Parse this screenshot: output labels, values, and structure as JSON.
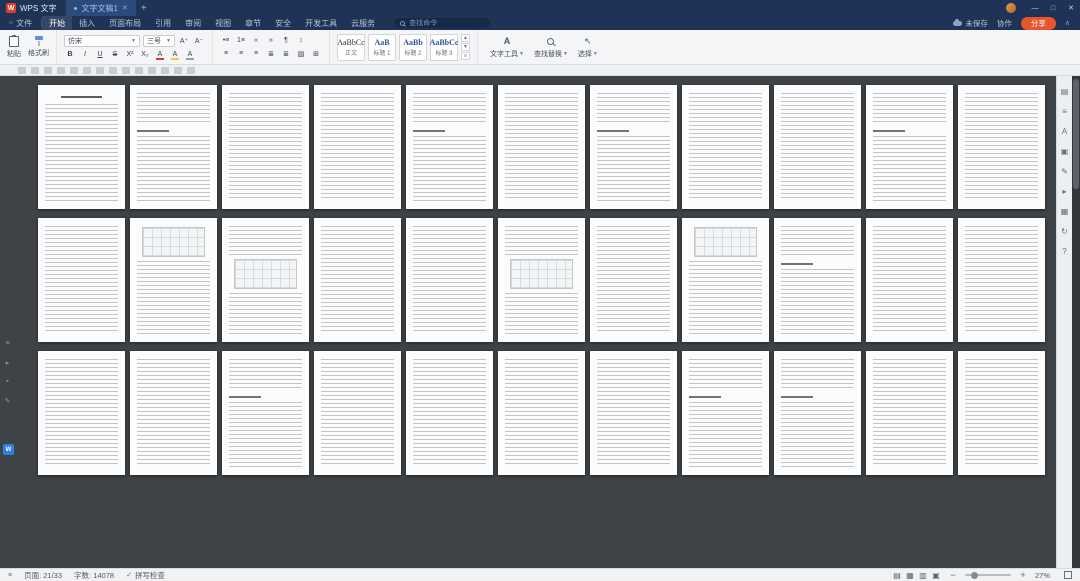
{
  "titlebar": {
    "app_name": "WPS 文字",
    "doc_tab": "文字文稿1",
    "new_tab": "+",
    "window": {
      "minimize": "—",
      "maximize": "□",
      "close": "✕"
    }
  },
  "menubar": {
    "file_label": "文件",
    "tabs": [
      "开始",
      "插入",
      "页面布局",
      "引用",
      "审阅",
      "视图",
      "章节",
      "安全",
      "开发工具",
      "云服务"
    ],
    "active_tab": "开始",
    "search_placeholder": "查找命令",
    "unsaved": "未保存",
    "collaborate": "协作",
    "share": "分享"
  },
  "ribbon": {
    "paste_label": "粘贴",
    "format_painter_label": "格式刷",
    "font_name": "仿宋",
    "font_size": "三号",
    "font_icons": [
      "bold",
      "italic",
      "underline",
      "strikethrough",
      "superscript",
      "subscript",
      "font-color",
      "highlight-color",
      "character-shading"
    ],
    "paragraph_icons_row1": [
      "bullet-list",
      "number-list",
      "decrease-indent",
      "increase-indent",
      "paragraph-marks",
      "line-spacing"
    ],
    "paragraph_icons_row2": [
      "align-left",
      "align-center",
      "align-right",
      "justify",
      "distribute",
      "shading",
      "borders"
    ],
    "styles": [
      {
        "sample": "AaBbCc",
        "label": "正文"
      },
      {
        "sample": "AaB",
        "label": "标题 1"
      },
      {
        "sample": "AaBb",
        "label": "标题 2"
      },
      {
        "sample": "AaBbCc",
        "label": "标题 3"
      }
    ],
    "tools": [
      {
        "label": "文字工具",
        "icon": "text-tools"
      },
      {
        "label": "查找替换",
        "icon": "find-replace"
      },
      {
        "label": "选择",
        "icon": "select-cursor"
      }
    ]
  },
  "mini_toolbar": {
    "icons": [
      "quick-icon-1",
      "quick-icon-2",
      "quick-icon-3",
      "quick-icon-4",
      "quick-icon-5",
      "quick-icon-6",
      "quick-icon-7",
      "quick-icon-8",
      "quick-icon-9",
      "quick-icon-10",
      "quick-icon-11",
      "quick-icon-12",
      "quick-icon-13",
      "quick-icon-14"
    ]
  },
  "left_rail": {
    "icons": [
      "panel-toggle",
      "bookmark",
      "marker",
      "annotate"
    ],
    "badge": "W"
  },
  "right_rail": {
    "icons": [
      "properties",
      "find",
      "styles-pane",
      "selection-pane",
      "edit-pane",
      "bookmark-pane",
      "table-pane",
      "history-pane",
      "help-pane"
    ]
  },
  "document": {
    "pages": [
      "title",
      "heading",
      "text",
      "text",
      "heading",
      "text",
      "heading",
      "text",
      "text",
      "heading",
      "text",
      "text",
      "figure-top",
      "figure-mid",
      "text",
      "text",
      "figure-mid",
      "text",
      "figure-top",
      "heading",
      "text",
      "text",
      "text",
      "text",
      "heading",
      "text",
      "text",
      "text",
      "text",
      "heading",
      "heading",
      "text",
      "text"
    ]
  },
  "statusbar": {
    "page_indicator": "页面: 21/33",
    "word_count": "字数: 14078",
    "spell_check": "拼写检查",
    "view_icons": [
      "eye-protect-view",
      "page-view",
      "web-view",
      "outline-view"
    ],
    "zoom_out": "−",
    "zoom_in": "+",
    "zoom_level": "27%"
  }
}
